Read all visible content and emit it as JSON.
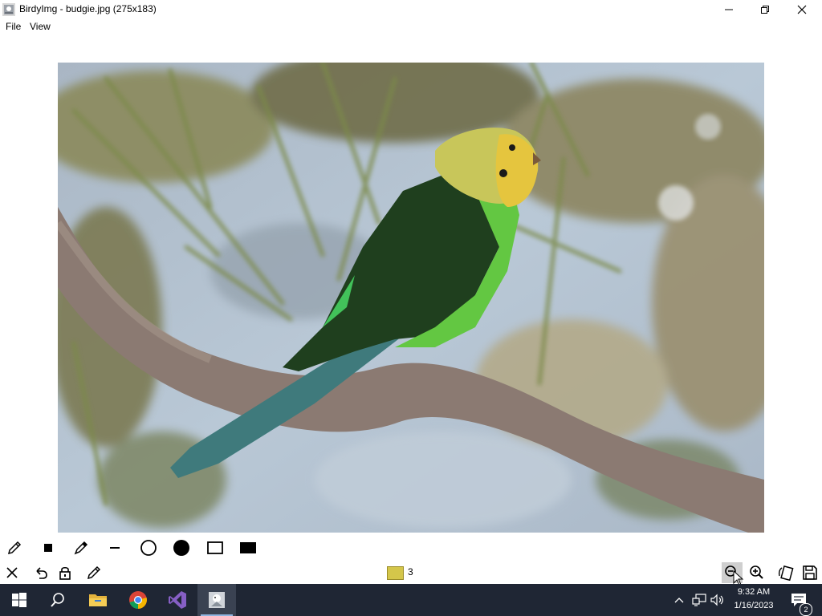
{
  "window": {
    "title": "BirdyImg - budgie.jpg (275x183)",
    "app_icon": "birdyimg-app-icon"
  },
  "menu": {
    "items": [
      {
        "label": "File"
      },
      {
        "label": "View"
      }
    ]
  },
  "canvas": {
    "image_name": "budgie.jpg"
  },
  "toolbar": {
    "draw_tools": [
      "pencil-icon",
      "square-brush-icon",
      "eyedropper-icon",
      "line-icon",
      "circle-outline-icon",
      "circle-filled-icon",
      "rectangle-outline-icon",
      "rectangle-filled-icon"
    ],
    "action_tools": [
      "close-icon",
      "undo-icon",
      "lock-icon",
      "pencil-icon"
    ],
    "color_swatch": {
      "color": "#d4c64a",
      "count": "3"
    },
    "view_tools": [
      "zoom-out-icon",
      "zoom-in-icon",
      "rotate-icon",
      "save-icon"
    ]
  },
  "taskbar": {
    "clock_time": "9:32 AM",
    "clock_date": "1/16/2023",
    "notification_count": "2"
  },
  "colors": {
    "taskbar_bg": "#1f2634",
    "swatch": "#d4c64a"
  }
}
